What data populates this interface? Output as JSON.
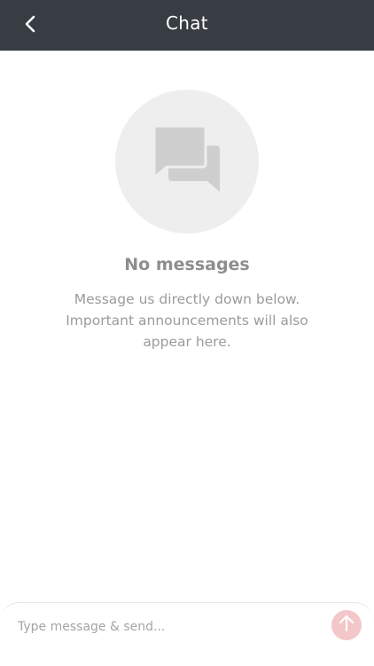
{
  "header": {
    "title": "Chat",
    "back_icon": "chevron-left-icon"
  },
  "empty_state": {
    "icon": "chat-bubbles-icon",
    "title": "No messages",
    "description": "Message us directly down below. Important announcements will also appear here."
  },
  "composer": {
    "placeholder": "Type message & send...",
    "value": "",
    "send_icon": "arrow-up-icon"
  },
  "colors": {
    "header_bg": "#383c43",
    "illustration_bg": "#eeeeee",
    "illustration_icon": "#cfcfcf",
    "send_button_bg": "#f3c6c9"
  }
}
